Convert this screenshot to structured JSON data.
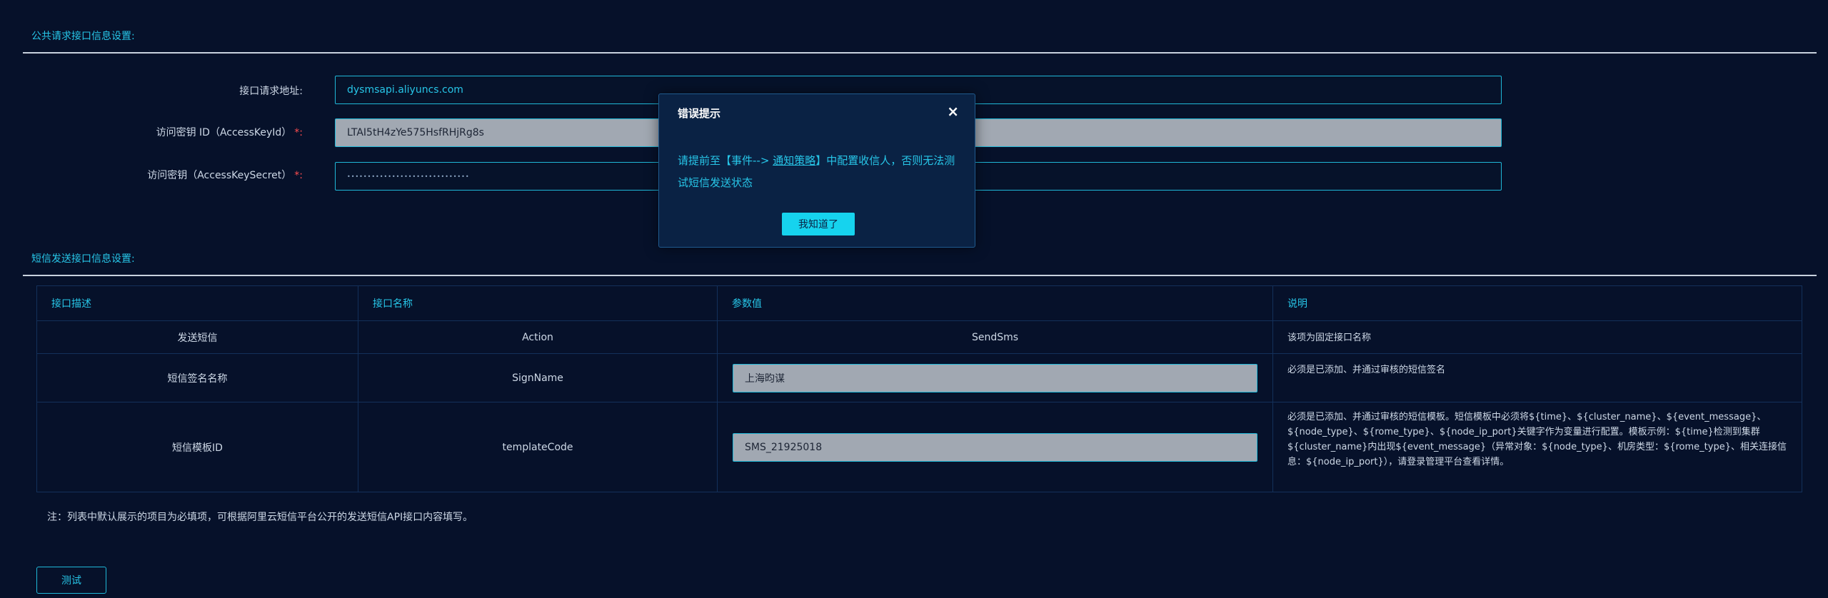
{
  "public_section": {
    "title": "公共请求接口信息设置:",
    "fields": [
      {
        "label": "接口请求地址:",
        "value": "dysmsapi.aliyuncs.com",
        "required": false
      },
      {
        "label": "访问密钥 ID（AccessKeyId）",
        "value": "LTAI5tH4zYe575HsfRHjRg8s",
        "required": true
      },
      {
        "label": "访问密钥（AccessKeySecret）",
        "value": "••••••••••••••••••••••••••••••",
        "required": true
      }
    ],
    "required_mark": "*:",
    "colon": ":"
  },
  "sms_section": {
    "title": "短信发送接口信息设置:",
    "table": {
      "headers": [
        "接口描述",
        "接口名称",
        "参数值",
        "说明"
      ],
      "rows": [
        {
          "desc": "发送短信",
          "name": "Action",
          "value": "SendSms",
          "note": "该项为固定接口名称"
        },
        {
          "desc": "短信签名名称",
          "name": "SignName",
          "value": "上海昀谋",
          "note": "必须是已添加、并通过审核的短信签名"
        },
        {
          "desc": "短信模板ID",
          "name": "templateCode",
          "value": "SMS_21925018",
          "note": "必须是已添加、并通过审核的短信模板。短信模板中必须将${time}、${cluster_name}、${event_message}、${node_type}、${rome_type}、${node_ip_port}关键字作为变量进行配置。模板示例：${time}检测到集群${cluster_name}内出现${event_message}（异常对象：${node_type}、机房类型：${rome_type}、相关连接信息：${node_ip_port}），请登录管理平台查看详情。"
        }
      ]
    },
    "footnote": "注：列表中默认展示的项目为必填项，可根据阿里云短信平台公开的发送短信API接口内容填写。",
    "test_button": "测试"
  },
  "modal": {
    "title": "错误提示",
    "close": "×",
    "message_pre": "请提前至【事件-->",
    "message_link": "通知策略",
    "message_post": "】中配置收信人，否则无法测试短信发送状态",
    "ok_button": "我知道了"
  },
  "colors": {
    "background": "#06112a",
    "accent": "#27c6e8",
    "required": "#ff4d4f",
    "button_bg": "#16d3ee"
  }
}
